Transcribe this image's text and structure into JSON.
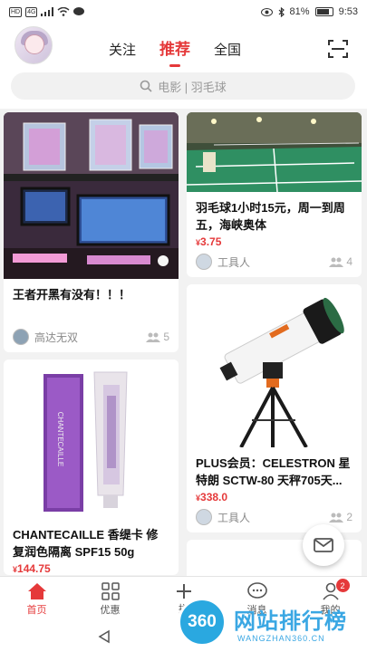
{
  "status": {
    "left_pills": [
      "HD",
      "4G"
    ],
    "battery_text": "81%",
    "battery_level": 0.81,
    "time": "9:53"
  },
  "header": {
    "tabs": [
      {
        "label": "关注",
        "active": false
      },
      {
        "label": "推荐",
        "active": true
      },
      {
        "label": "全国",
        "active": false
      }
    ]
  },
  "search": {
    "placeholder": "电影 | 羽毛球"
  },
  "feed": {
    "left": [
      {
        "title": "王者开黑有没有！！！",
        "user": "高达无双",
        "count": "5"
      },
      {
        "title": "CHANTECAILLE 香缇卡 修复润色隔离 SPF15 50g",
        "price": "144.75",
        "currency": "¥",
        "product_brand": "CHANTECAILLE"
      }
    ],
    "right": [
      {
        "title": "羽毛球1小时15元，周一到周五，海峡奥体",
        "price": "3.75",
        "currency": "¥",
        "user": "工具人",
        "count": "4"
      },
      {
        "title": "PLUS会员：CELESTRON 星特朗 SCTW-80 天秤705天...",
        "price": "338.0",
        "currency": "¥",
        "user": "工具人",
        "count": "2"
      }
    ]
  },
  "bottom_nav": [
    {
      "label": "首页",
      "icon": "home-icon",
      "active": true
    },
    {
      "label": "优惠",
      "icon": "grid-icon",
      "active": false
    },
    {
      "label": "拼",
      "icon": "plus-icon",
      "active": false
    },
    {
      "label": "消息",
      "icon": "chat-icon",
      "active": false
    },
    {
      "label": "我的",
      "icon": "person-icon",
      "active": false,
      "badge": "2"
    }
  ],
  "watermark": {
    "logo": "360",
    "text": "网站排行榜",
    "url": "WANGZHAN360.CN"
  },
  "colors": {
    "accent": "#e5393a",
    "background": "#f2f2f2"
  }
}
